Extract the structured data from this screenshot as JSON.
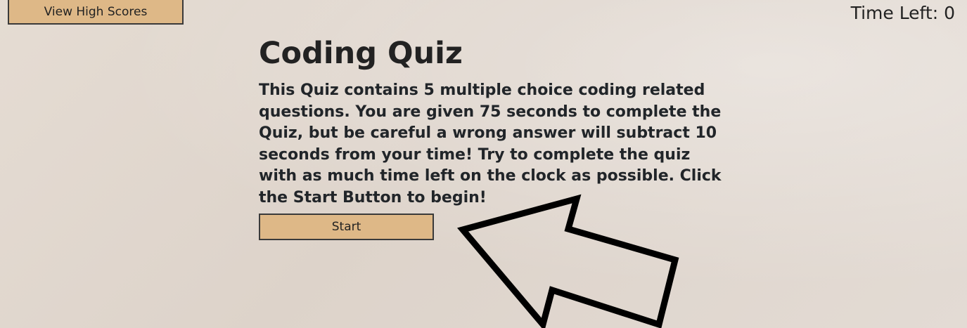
{
  "header": {
    "high_scores_label": "View High Scores",
    "timer_text": "Time Left: 0"
  },
  "main": {
    "title": "Coding Quiz",
    "description": "This Quiz contains 5 multiple choice coding related questions. You are given 75 seconds to complete the Quiz, but be careful a wrong answer will subtract 10 seconds from your time! Try to complete the quiz with as much time left on the clock as possible. Click the Start Button to begin!",
    "start_label": "Start"
  },
  "colors": {
    "button_bg": "#deb887",
    "button_border": "#3a3a3a",
    "text": "#212529",
    "arrow_stroke": "#000000",
    "arrow_fill": "#ffffff"
  },
  "icons": {
    "pointer_arrow": "arrow-pointing-to-start-icon"
  }
}
